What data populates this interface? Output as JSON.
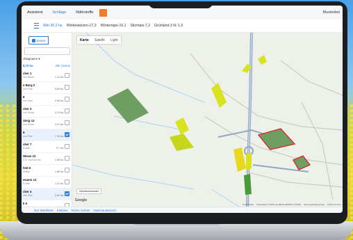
{
  "topnav": {
    "items": [
      {
        "label": "Assistent",
        "active": false
      },
      {
        "label": "Schläge",
        "active": true
      },
      {
        "label": "Nährstoffe",
        "active": false
      }
    ],
    "right_label": "Musterbet"
  },
  "filterbar": {
    "chips": [
      {
        "label": "Alle-36,2 ha",
        "active": true
      },
      {
        "label": "Winterweizen-17,3",
        "active": false
      },
      {
        "label": "Winterraps-10,1",
        "active": false
      },
      {
        "label": "Silomais-7,2",
        "active": false
      },
      {
        "label": "Grünland 3 N.-1,6",
        "active": false
      }
    ]
  },
  "sidebar": {
    "toggle": {
      "detail_label": "Detail",
      "map_label": "Karte"
    },
    "sort_label": "chlagname ▾",
    "total_area": "8,70 ha",
    "select_all": "Alle | Keine",
    "items": [
      {
        "name": "cker 1",
        "sub": "sen Briant",
        "area": "1,14 ha",
        "checked": false
      },
      {
        "name": "e Burg 2",
        "sub": "sen Flair",
        "area": "5,69 ha",
        "checked": false
      },
      {
        "name": "8",
        "sub": "sen Flair",
        "area": "0,98 ha",
        "checked": false
      },
      {
        "name": "cker 3",
        "sub": "sen Smart",
        "area": "4,79 ha",
        "checked": false
      },
      {
        "name": "Steig 12",
        "sub": "sen Smart",
        "area": "3,21 ha",
        "checked": false
      },
      {
        "name": "9",
        "sub": "sen Flair",
        "area": "7,34 ha",
        "checked": true
      },
      {
        "name": "cker 7",
        "sub": "Krabin",
        "area": "0,7 ha",
        "checked": false
      },
      {
        "name": "Wiese 10",
        "sub": "4 N. TopSoft Ha...",
        "area": "1,56 ha",
        "checked": false
      },
      {
        "name": "feld 6",
        "sub": "Krabin",
        "area": "1,88 ha",
        "checked": false
      },
      {
        "name": "ewann 13",
        "sub": "Krabin",
        "area": "1,21 ha",
        "checked": false
      },
      {
        "name": "cker 4",
        "sub": "sen Flair",
        "area": "2,62 ha",
        "checked": true
      },
      {
        "name": "k 5",
        "sub": "sen Smart",
        "area": "1 ha",
        "checked": false
      }
    ]
  },
  "map": {
    "tabs": [
      {
        "label": "Karte",
        "active": true
      },
      {
        "label": "Satellit",
        "active": false
      },
      {
        "label": "Light",
        "active": false
      }
    ],
    "map_button": "Mehrfachauswahl",
    "google_label": "Google",
    "footer": [
      "Kurzbefehle",
      "Kartendaten ©2023 GeoBasis-DE/BKG (©2009)",
      "Nutzungsbedingungen",
      "Fehler bei Goo"
    ],
    "colors": {
      "field_green": "#6f9e63",
      "field_yellow": "#d9e21f",
      "selected_outline": "#d8232a",
      "road": "#a9d3f5"
    }
  },
  "bottombar": {
    "items": [
      "Nur Markierte",
      "Inaktive",
      "Rotes Gebiet",
      "Datenaustausch"
    ]
  }
}
